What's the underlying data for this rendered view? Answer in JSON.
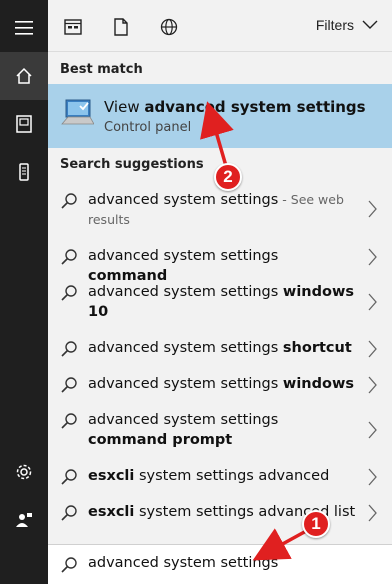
{
  "toolbar": {
    "filters_label": "Filters"
  },
  "best_match": {
    "heading": "Best match",
    "title_prefix": "View ",
    "title_bold": "advanced system settings",
    "subtitle": "Control panel"
  },
  "suggestions": {
    "heading": "Search suggestions",
    "items": [
      {
        "normal": "advanced system settings",
        "bold": "",
        "web": " - See web results"
      },
      {
        "normal": "advanced system settings ",
        "bold": "command",
        "web": ""
      },
      {
        "normal": "advanced system settings ",
        "bold": "windows 10",
        "web": ""
      },
      {
        "normal": "advanced system settings ",
        "bold": "shortcut",
        "web": ""
      },
      {
        "normal": "advanced system settings ",
        "bold": "windows",
        "web": ""
      },
      {
        "normal": "advanced system settings ",
        "bold": "command prompt",
        "web": ""
      },
      {
        "normal": " system settings advanced",
        "bold": "esxcli",
        "web": "",
        "bold_first": true
      },
      {
        "normal": " system settings advanced list",
        "bold": "esxcli",
        "web": "",
        "bold_first": true
      }
    ]
  },
  "search": {
    "value": "advanced system settings"
  },
  "annotations": {
    "badge_1": "1",
    "badge_2": "2"
  },
  "colors": {
    "rail": "#1f1f1f",
    "rail_active": "#3a3a3a",
    "best_match_bg": "#a9d1ea",
    "annotation_red": "#e02020"
  },
  "icons": {
    "rail": [
      "hamburger-icon",
      "home-icon",
      "documents-icon",
      "device-icon",
      "settings-gear-icon",
      "feedback-person-icon"
    ],
    "toolbar": [
      "apps-icon",
      "document-icon",
      "globe-icon",
      "chevron-down-icon"
    ]
  }
}
